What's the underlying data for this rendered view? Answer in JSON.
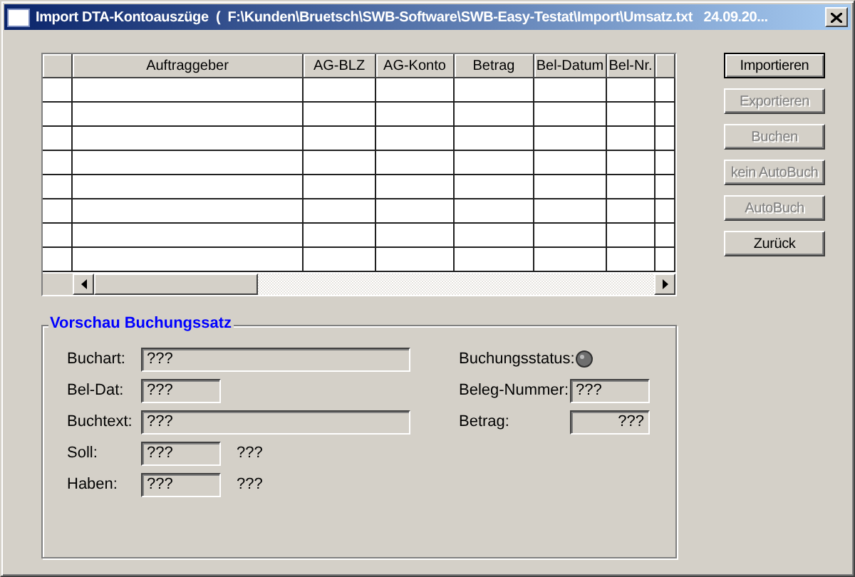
{
  "window": {
    "title": "Import DTA-Kontoauszüge  (  F:\\Kunden\\Bruetsch\\SWB-Software\\SWB-Easy-Testat\\Import\\Umsatz.txt   24.09.20..."
  },
  "table": {
    "columns": [
      "Auftraggeber",
      "AG-BLZ",
      "AG-Konto",
      "Betrag",
      "Bel-Datum",
      "Bel-Nr."
    ]
  },
  "buttons": [
    {
      "label": "Importieren",
      "disabled": false,
      "default": true
    },
    {
      "label": "Exportieren",
      "disabled": true,
      "default": false
    },
    {
      "label": "Buchen",
      "disabled": true,
      "default": false
    },
    {
      "label": "kein AutoBuch",
      "disabled": true,
      "default": false
    },
    {
      "label": "AutoBuch",
      "disabled": true,
      "default": false
    },
    {
      "label": "Zurück",
      "disabled": false,
      "default": false
    }
  ],
  "preview": {
    "title": "Vorschau Buchungssatz",
    "left": [
      {
        "label": "Buchart:",
        "value": "???",
        "kind": "wide"
      },
      {
        "label": "Bel-Dat:",
        "value": "???",
        "kind": "short"
      },
      {
        "label": "Buchtext:",
        "value": "???",
        "kind": "wide"
      },
      {
        "label": "Soll:",
        "value": "???",
        "kind": "short",
        "note": "???"
      },
      {
        "label": "Haben:",
        "value": "???",
        "kind": "short",
        "note": "???"
      }
    ],
    "status_label": "Buchungsstatus:",
    "right": [
      {
        "label": "Beleg-Nummer:",
        "value": "???",
        "kind": "text"
      },
      {
        "label": "Betrag:",
        "value": "???",
        "kind": "amount"
      }
    ]
  }
}
